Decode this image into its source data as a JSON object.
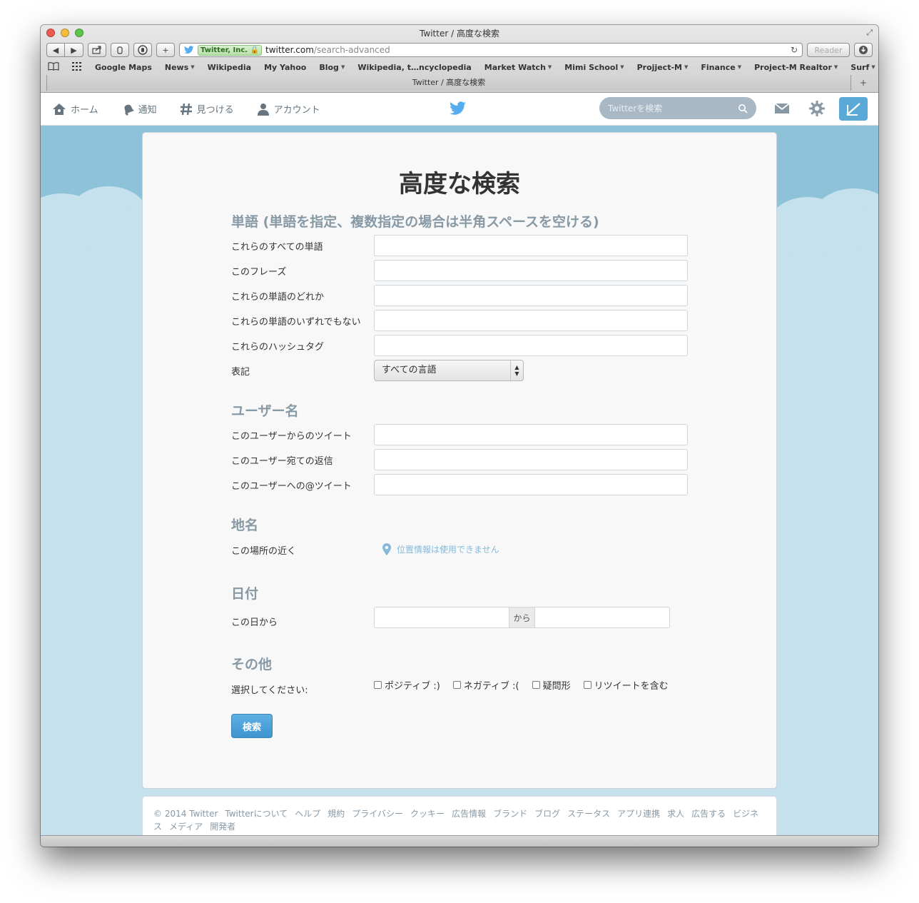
{
  "window": {
    "title": "Twitter / 高度な検索",
    "tab_title": "Twitter / 高度な検索"
  },
  "toolbar": {
    "ev_label": "Twitter, Inc.",
    "url_host": "twitter.com",
    "url_path": "/search-advanced",
    "reader_label": "Reader"
  },
  "bookmarks": {
    "items": [
      {
        "label": "Google Maps",
        "menu": false
      },
      {
        "label": "News",
        "menu": true
      },
      {
        "label": "Wikipedia",
        "menu": false
      },
      {
        "label": "My Yahoo",
        "menu": false
      },
      {
        "label": "Blog",
        "menu": true
      },
      {
        "label": "Wikipedia, t…ncyclopedia",
        "menu": false
      },
      {
        "label": "Market Watch",
        "menu": true
      },
      {
        "label": "Mimi School",
        "menu": true
      },
      {
        "label": "Projject-M",
        "menu": true
      },
      {
        "label": "Finance",
        "menu": true
      },
      {
        "label": "Project-M Realtor",
        "menu": true
      },
      {
        "label": "Surf",
        "menu": true
      }
    ]
  },
  "twitter_nav": {
    "home": "ホーム",
    "notifications": "通知",
    "discover": "見つける",
    "account": "アカウント",
    "search_placeholder": "Twitterを検索"
  },
  "form": {
    "title": "高度な検索",
    "words": {
      "heading": "単語 (単語を指定、複数指定の場合は半角スペースを空ける)",
      "all_words": "これらのすべての単語",
      "phrase": "このフレーズ",
      "any_words": "これらの単語のどれか",
      "none_words": "これらの単語のいずれでもない",
      "hashtags": "これらのハッシュタグ",
      "language_label": "表記",
      "language_value": "すべての言語"
    },
    "people": {
      "heading": "ユーザー名",
      "from": "このユーザーからのツイート",
      "to": "このユーザー宛ての返信",
      "mention": "このユーザーへの@ツイート"
    },
    "places": {
      "heading": "地名",
      "near": "この場所の近く",
      "location_link": "位置情報は使用できません"
    },
    "dates": {
      "heading": "日付",
      "since": "この日から",
      "separator": "から"
    },
    "other": {
      "heading": "その他",
      "select_label": "選択してください:",
      "options": [
        "ポジティブ :)",
        "ネガティブ :(",
        "疑問形",
        "リツイートを含む"
      ]
    },
    "submit": "検索"
  },
  "footer": {
    "links": [
      "© 2014 Twitter",
      "Twitterについて",
      "ヘルプ",
      "規約",
      "プライバシー",
      "クッキー",
      "広告情報",
      "ブランド",
      "ブログ",
      "ステータス",
      "アプリ連携",
      "求人",
      "広告する",
      "ビジネス",
      "メディア",
      "開発者"
    ]
  },
  "colors": {
    "brand_blue": "#55acee",
    "section_heading": "#8899a6",
    "page_background": "#c5e1ed",
    "link": "#86b9d9"
  }
}
